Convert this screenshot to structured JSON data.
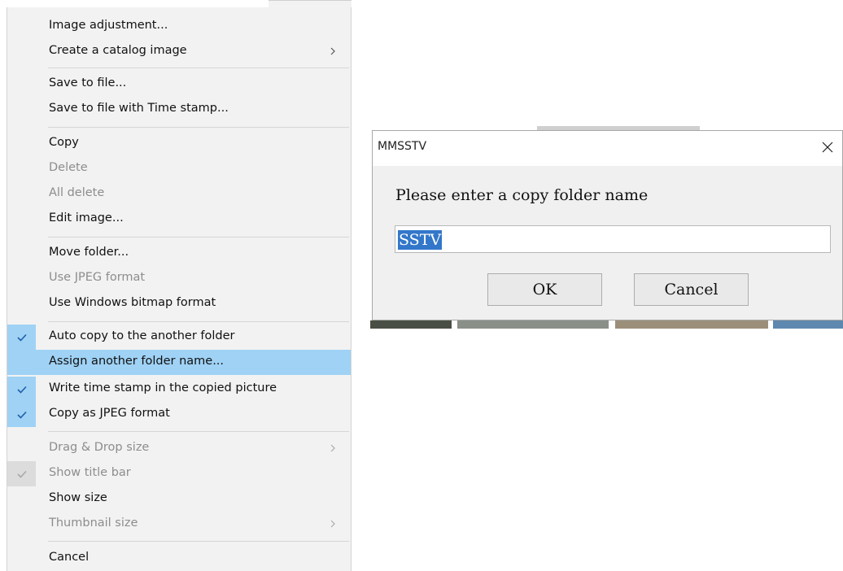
{
  "menu": {
    "items": [
      {
        "label": "Image adjustment...",
        "state": "normal",
        "checked": false,
        "submenu": false
      },
      {
        "label": "Create a catalog image",
        "state": "normal",
        "checked": false,
        "submenu": true
      },
      {
        "label": "Save to file...",
        "state": "normal",
        "checked": false,
        "submenu": false
      },
      {
        "label": "Save to file with Time stamp...",
        "state": "normal",
        "checked": false,
        "submenu": false
      },
      {
        "label": "Copy",
        "state": "normal",
        "checked": false,
        "submenu": false
      },
      {
        "label": "Delete",
        "state": "disabled",
        "checked": false,
        "submenu": false
      },
      {
        "label": "All delete",
        "state": "disabled",
        "checked": false,
        "submenu": false
      },
      {
        "label": "Edit image...",
        "state": "normal",
        "checked": false,
        "submenu": false
      },
      {
        "label": "Move folder...",
        "state": "normal",
        "checked": false,
        "submenu": false
      },
      {
        "label": "Use JPEG format",
        "state": "disabled",
        "checked": false,
        "submenu": false
      },
      {
        "label": "Use Windows bitmap format",
        "state": "normal",
        "checked": false,
        "submenu": false
      },
      {
        "label": "Auto copy to the another folder",
        "state": "normal",
        "checked": true,
        "submenu": false
      },
      {
        "label": "Assign another folder name...",
        "state": "highlighted",
        "checked": false,
        "submenu": false
      },
      {
        "label": "Write time stamp in the copied picture",
        "state": "normal",
        "checked": true,
        "submenu": false
      },
      {
        "label": "Copy as JPEG format",
        "state": "normal",
        "checked": true,
        "submenu": false
      },
      {
        "label": "Drag & Drop size",
        "state": "disabled",
        "checked": false,
        "submenu": true
      },
      {
        "label": "Show title bar",
        "state": "disabled",
        "checked": true,
        "submenu": false
      },
      {
        "label": "Show size",
        "state": "normal",
        "checked": false,
        "submenu": false
      },
      {
        "label": "Thumbnail size",
        "state": "disabled",
        "checked": false,
        "submenu": true
      },
      {
        "label": "Cancel",
        "state": "normal",
        "checked": false,
        "submenu": false
      }
    ]
  },
  "dialog": {
    "title": "MMSSTV",
    "prompt": "Please enter a copy folder name",
    "input_value": "SSTV",
    "ok_label": "OK",
    "cancel_label": "Cancel"
  },
  "icons": {
    "check": "check-icon",
    "submenu": "chevron-right-icon",
    "close": "close-icon"
  },
  "colors": {
    "menu_bg": "#f2f2f2",
    "highlight": "#9fd2f5",
    "disabled_text": "#8d8d8d",
    "selection": "#3277c9",
    "dialog_body": "#f0f0f0"
  }
}
